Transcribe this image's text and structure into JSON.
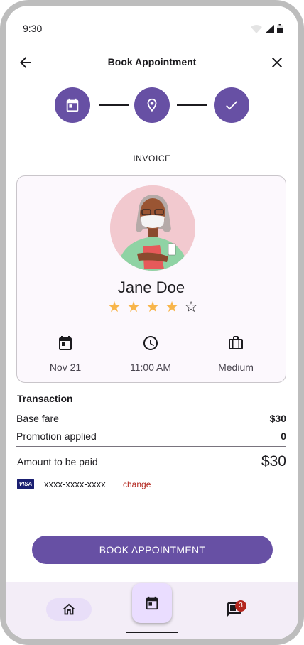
{
  "status_bar": {
    "time": "9:30"
  },
  "app_bar": {
    "title": "Book Appointment"
  },
  "steps": [
    {
      "icon": "calendar-icon",
      "state": "completed"
    },
    {
      "icon": "location-pin-icon",
      "state": "completed"
    },
    {
      "icon": "check-icon",
      "state": "current"
    }
  ],
  "section_label": "INVOICE",
  "doctor": {
    "name": "Jane Doe",
    "rating": 4,
    "rating_max": 5
  },
  "appointment": {
    "date": "Nov 21",
    "time": "11:00 AM",
    "size": "Medium"
  },
  "transaction": {
    "title": "Transaction",
    "base_fare_label": "Base fare",
    "base_fare_value": "$30",
    "promo_label": "Promotion applied",
    "promo_value": "0",
    "total_label": "Amount to be paid",
    "total_value": "$30"
  },
  "payment": {
    "brand": "VISA",
    "card_number": "xxxx-xxxx-xxxx",
    "change_label": "change"
  },
  "book_button": "BOOK APPOINTMENT",
  "bottom_nav": {
    "messages_badge": "3"
  },
  "colors": {
    "primary": "#6750a4",
    "star": "#f8b54a",
    "error": "#b3261e",
    "nav_background": "#f3edf7"
  }
}
